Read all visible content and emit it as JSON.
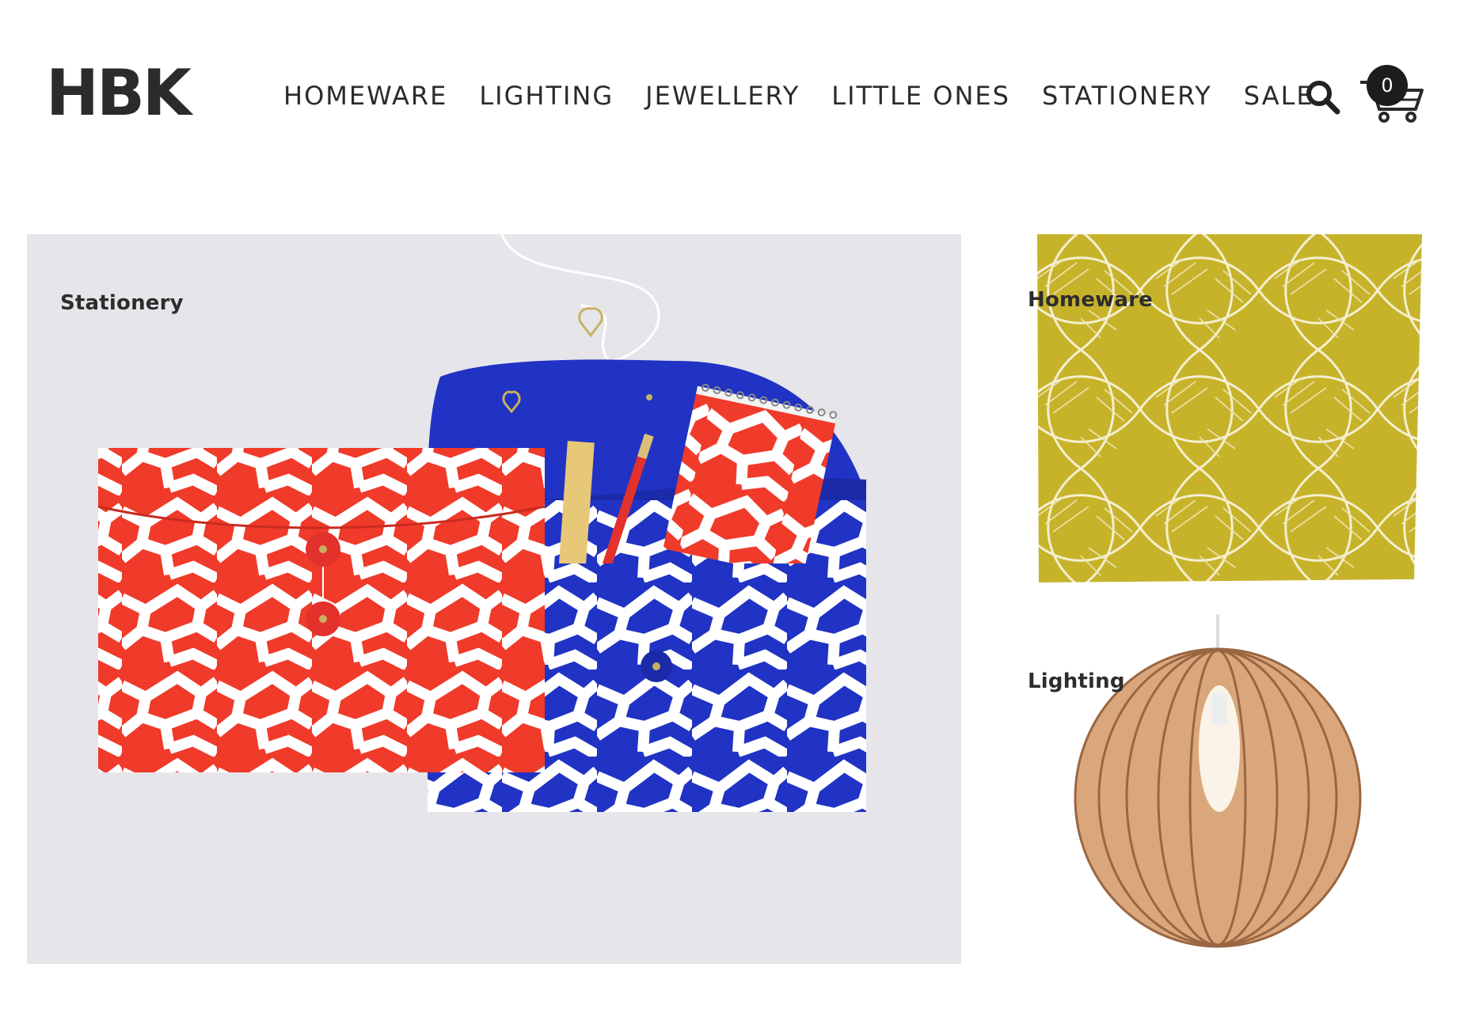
{
  "header": {
    "logo": "HBK",
    "nav": [
      "HOMEWARE",
      "LIGHTING",
      "JEWELLERY",
      "LITTLE ONES",
      "STATIONERY",
      "SALE"
    ],
    "search_icon": "search-icon",
    "cart_icon": "cart-icon",
    "cart_count": "0"
  },
  "tiles": {
    "stationery": {
      "label": "Stationery"
    },
    "homeware": {
      "label": "Homeware"
    },
    "lighting": {
      "label": "Lighting"
    }
  },
  "colors": {
    "envelope_red": "#f03a2a",
    "envelope_blue": "#2033c4",
    "cushion_yellow": "#c7b32a",
    "wood": "#d9a77b"
  }
}
